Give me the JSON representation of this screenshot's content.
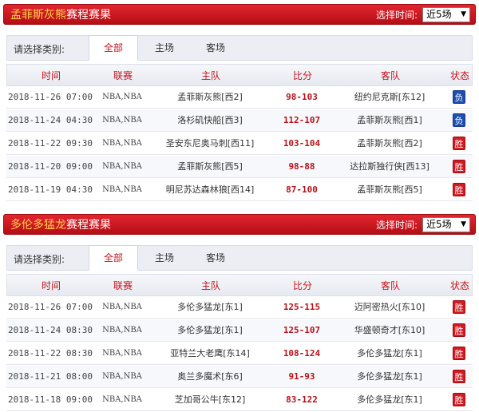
{
  "colors": {
    "accent": "#c2151d",
    "win": "#d21a22",
    "loss": "#1e4fb0",
    "team_title": "#ffd24a"
  },
  "panels": [
    {
      "team_name": "孟菲斯灰熊",
      "title_suffix": "赛程赛果",
      "selector_label": "选择时间:",
      "selector_value": "近5场",
      "filter_label": "请选择类别:",
      "tabs": [
        "全部",
        "主场",
        "客场"
      ],
      "active_tab": 0,
      "headers": [
        "时间",
        "联赛",
        "主队",
        "比分",
        "客队",
        "状态"
      ],
      "rows": [
        {
          "time": "2018-11-26 07:00",
          "league": "NBA,NBA",
          "home": "孟菲斯灰熊[西2]",
          "score": "98-103",
          "away": "纽约尼克斯[东12]",
          "result": "负",
          "win": false
        },
        {
          "time": "2018-11-24 04:30",
          "league": "NBA,NBA",
          "home": "洛杉矶快船[西3]",
          "score": "112-107",
          "away": "孟菲斯灰熊[西1]",
          "result": "负",
          "win": false
        },
        {
          "time": "2018-11-22 09:30",
          "league": "NBA,NBA",
          "home": "圣安东尼奥马刺[西11]",
          "score": "103-104",
          "away": "孟菲斯灰熊[西2]",
          "result": "胜",
          "win": true
        },
        {
          "time": "2018-11-20 09:00",
          "league": "NBA,NBA",
          "home": "孟菲斯灰熊[西5]",
          "score": "98-88",
          "away": "达拉斯独行侠[西13]",
          "result": "胜",
          "win": true
        },
        {
          "time": "2018-11-19 04:30",
          "league": "NBA,NBA",
          "home": "明尼苏达森林狼[西14]",
          "score": "87-100",
          "away": "孟菲斯灰熊[西5]",
          "result": "胜",
          "win": true
        }
      ]
    },
    {
      "team_name": "多伦多猛龙",
      "title_suffix": "赛程赛果",
      "selector_label": "选择时间:",
      "selector_value": "近5场",
      "filter_label": "请选择类别:",
      "tabs": [
        "全部",
        "主场",
        "客场"
      ],
      "active_tab": 0,
      "headers": [
        "时间",
        "联赛",
        "主队",
        "比分",
        "客队",
        "状态"
      ],
      "rows": [
        {
          "time": "2018-11-26 07:00",
          "league": "NBA,NBA",
          "home": "多伦多猛龙[东1]",
          "score": "125-115",
          "away": "迈阿密热火[东10]",
          "result": "胜",
          "win": true
        },
        {
          "time": "2018-11-24 08:30",
          "league": "NBA,NBA",
          "home": "多伦多猛龙[东1]",
          "score": "125-107",
          "away": "华盛顿奇才[东10]",
          "result": "胜",
          "win": true
        },
        {
          "time": "2018-11-22 08:30",
          "league": "NBA,NBA",
          "home": "亚特兰大老鹰[东14]",
          "score": "108-124",
          "away": "多伦多猛龙[东1]",
          "result": "胜",
          "win": true
        },
        {
          "time": "2018-11-21 08:00",
          "league": "NBA,NBA",
          "home": "奥兰多魔术[东6]",
          "score": "91-93",
          "away": "多伦多猛龙[东1]",
          "result": "胜",
          "win": true
        },
        {
          "time": "2018-11-18 09:00",
          "league": "NBA,NBA",
          "home": "芝加哥公牛[东12]",
          "score": "83-122",
          "away": "多伦多猛龙[东1]",
          "result": "胜",
          "win": true
        }
      ]
    }
  ]
}
